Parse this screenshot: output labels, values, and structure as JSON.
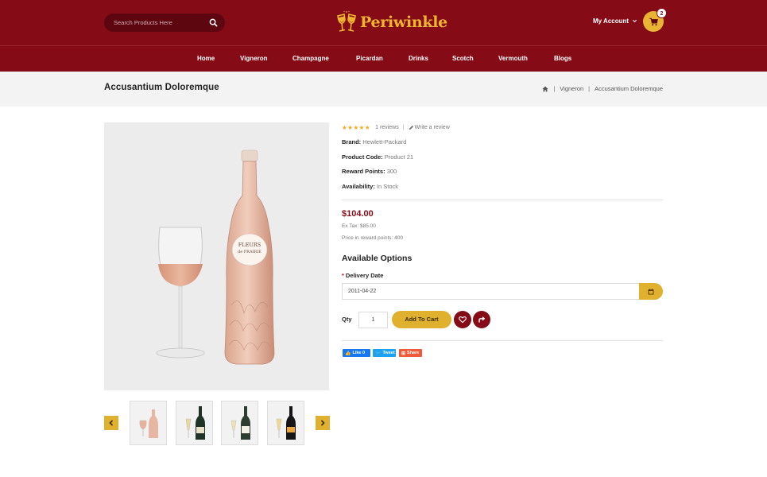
{
  "header": {
    "search_placeholder": "Search Products Here",
    "brand": "Periwinkle",
    "account_label": "My Account",
    "cart_count": "2"
  },
  "nav": [
    "Home",
    "Vigneron",
    "Champagne",
    "Picardan",
    "Drinks",
    "Scotch",
    "Vermouth",
    "Blogs"
  ],
  "page": {
    "title": "Accusantium Doloremque",
    "breadcrumb": [
      "Vigneron",
      "Accusantium Doloremque"
    ]
  },
  "product": {
    "rating_stars": 5,
    "reviews": "1 reviews",
    "write_review": "Write a review",
    "specs": [
      {
        "label": "Brand:",
        "value": "Hewlett-Packard"
      },
      {
        "label": "Product Code:",
        "value": "Product 21"
      },
      {
        "label": "Reward Points:",
        "value": "300"
      },
      {
        "label": "Availability:",
        "value": "In Stock"
      }
    ],
    "price": "$104.00",
    "ex_tax": "Ex Tax: $85.00",
    "reward_price": "Price in reward points: 400",
    "options_title": "Available Options",
    "delivery_label": "Delivery Date",
    "delivery_value": "2011-04-22",
    "qty_label": "Qty",
    "qty_value": "1",
    "add_to_cart": "Add To Cart",
    "label_art": {
      "line1": "FLEURS",
      "line2": "de PRAIRIE"
    }
  },
  "social": {
    "like": "Like 0",
    "tweet": "Tweet",
    "share": "Share"
  },
  "colors": {
    "primary": "#850b16",
    "accent": "#e0b02f",
    "star": "#f3a91c"
  }
}
